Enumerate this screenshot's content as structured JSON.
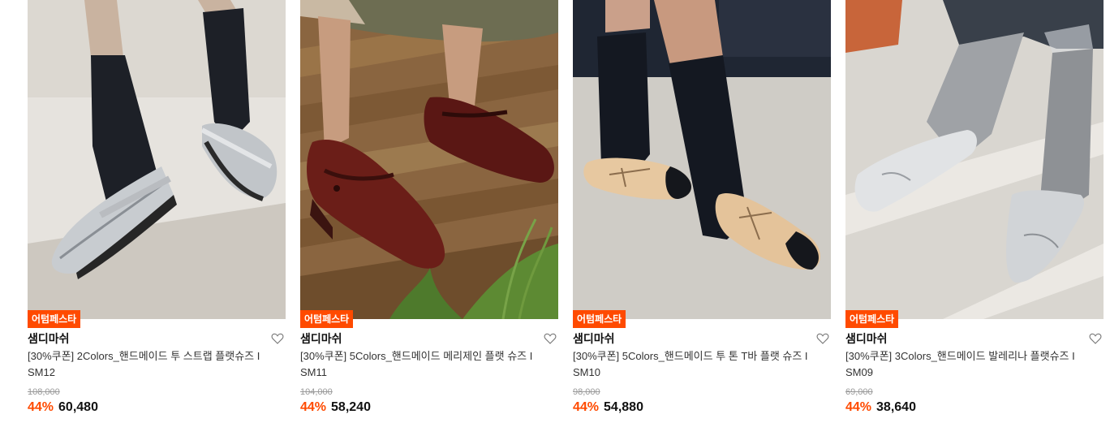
{
  "products": [
    {
      "badge": "어텀페스타",
      "brand": "샘디마쉬",
      "title": "[30%쿠폰] 2Colors_핸드메이드 투 스트랩 플랫슈즈 I SM12",
      "original_price": "108,000",
      "discount": "44%",
      "price": "60,480",
      "image_icon": "silver-two-strap-flats-photo"
    },
    {
      "badge": "어텀페스타",
      "brand": "샘디마쉬",
      "title": "[30%쿠폰] 5Colors_핸드메이드 메리제인 플랫 슈즈 I SM11",
      "original_price": "104,000",
      "discount": "44%",
      "price": "58,240",
      "image_icon": "burgundy-maryjane-flats-photo"
    },
    {
      "badge": "어텀페스타",
      "brand": "샘디마쉬",
      "title": "[30%쿠폰] 5Colors_핸드메이드 투 톤 T바 플랫 슈즈 I SM10",
      "original_price": "98,000",
      "discount": "44%",
      "price": "54,880",
      "image_icon": "beige-tbar-flats-photo"
    },
    {
      "badge": "어텀페스타",
      "brand": "샘디마쉬",
      "title": "[30%쿠폰] 3Colors_핸드메이드 발레리나 플랫슈즈 I SM09",
      "original_price": "69,000",
      "discount": "44%",
      "price": "38,640",
      "image_icon": "silver-ballerina-flats-photo"
    }
  ],
  "colors": {
    "accent": "#ff4a00",
    "text": "#111111",
    "muted": "#9a9a9a"
  }
}
